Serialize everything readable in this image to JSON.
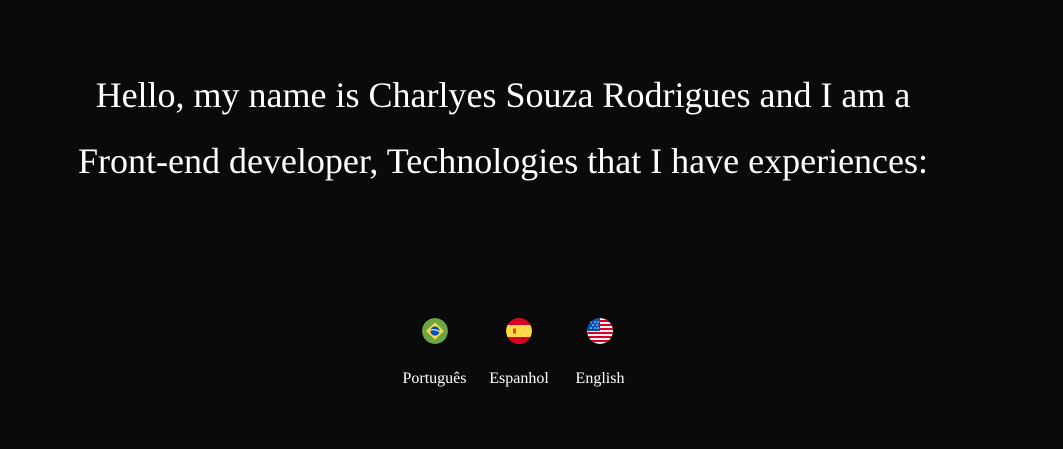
{
  "intro": {
    "line1": "Hello, my name is Charlyes Souza Rodrigues and I am a",
    "line2": "Front-end developer, Technologies that I have experiences:"
  },
  "languages": [
    {
      "label": "Português",
      "icon": "brazil-flag-icon",
      "colors": [
        "#6da544",
        "#ffda44",
        "#0052b4"
      ]
    },
    {
      "label": "Espanhol",
      "icon": "spain-flag-icon",
      "colors": [
        "#d80027",
        "#ffda44"
      ]
    },
    {
      "label": "English",
      "icon": "usa-flag-icon",
      "colors": [
        "#d80027",
        "#f0f0f0",
        "#0052b4"
      ]
    }
  ],
  "colors": {
    "background": "#0a0a0a",
    "text": "#ffffff"
  }
}
